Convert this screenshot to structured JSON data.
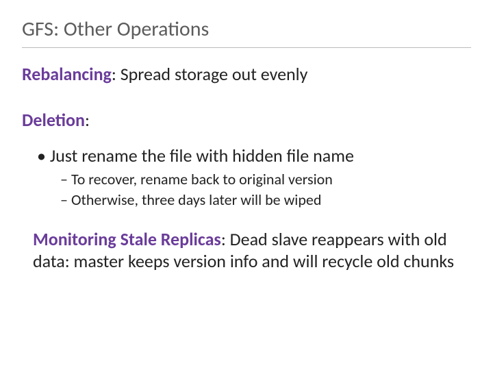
{
  "title": "GFS: Other Operations",
  "rebalancing": {
    "label": "Rebalancing",
    "text": ": Spread storage out evenly"
  },
  "deletion": {
    "label": "Deletion",
    "colon": ":",
    "bullet1": "Just rename the file with hidden file name",
    "sub1": "To recover, rename back to original version",
    "sub2": "Otherwise, three days later will be wiped"
  },
  "monitoring": {
    "label": "Monitoring Stale Replicas",
    "text": ": Dead slave reappears with old data: master keeps version info and will recycle old chunks"
  }
}
